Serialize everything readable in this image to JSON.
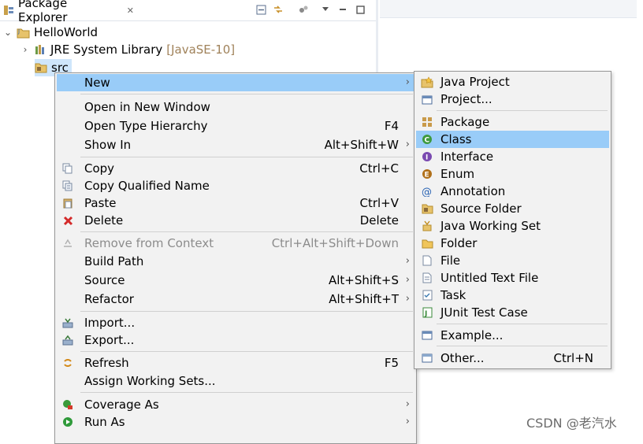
{
  "explorer": {
    "tab_title": "Package Explorer",
    "tab_close": "✕",
    "tree": {
      "project": "HelloWorld",
      "jre_label": "JRE System Library",
      "jre_decor": "[JavaSE-10]",
      "src": "src"
    }
  },
  "context_menu": {
    "items": [
      {
        "label": "New",
        "submenu": true,
        "highlighted": true
      },
      {
        "label": "Open in New Window"
      },
      {
        "label": "Open Type Hierarchy",
        "accel": "F4"
      },
      {
        "label": "Show In",
        "accel": "Alt+Shift+W",
        "submenu": true
      },
      {
        "label": "Copy",
        "accel": "Ctrl+C",
        "icon": "copy-icon"
      },
      {
        "label": "Copy Qualified Name",
        "icon": "copy-qualified-icon"
      },
      {
        "label": "Paste",
        "accel": "Ctrl+V",
        "icon": "paste-icon"
      },
      {
        "label": "Delete",
        "accel": "Delete",
        "icon": "delete-icon"
      },
      {
        "label": "Remove from Context",
        "accel": "Ctrl+Alt+Shift+Down",
        "disabled": true,
        "icon": "remove-context-icon"
      },
      {
        "label": "Build Path",
        "submenu": true
      },
      {
        "label": "Source",
        "accel": "Alt+Shift+S",
        "submenu": true
      },
      {
        "label": "Refactor",
        "accel": "Alt+Shift+T",
        "submenu": true
      },
      {
        "label": "Import...",
        "icon": "import-icon"
      },
      {
        "label": "Export...",
        "icon": "export-icon"
      },
      {
        "label": "Refresh",
        "accel": "F5",
        "icon": "refresh-icon"
      },
      {
        "label": "Assign Working Sets..."
      },
      {
        "label": "Coverage As",
        "submenu": true,
        "icon": "coverage-icon"
      },
      {
        "label": "Run As",
        "submenu": true,
        "icon": "run-icon"
      }
    ]
  },
  "new_submenu": {
    "items": [
      {
        "label": "Java Project",
        "icon": "java-project-icon"
      },
      {
        "label": "Project...",
        "icon": "project-icon"
      },
      {
        "label": "Package",
        "icon": "package-icon"
      },
      {
        "label": "Class",
        "icon": "class-icon",
        "highlighted": true
      },
      {
        "label": "Interface",
        "icon": "interface-icon"
      },
      {
        "label": "Enum",
        "icon": "enum-icon"
      },
      {
        "label": "Annotation",
        "icon": "annotation-icon"
      },
      {
        "label": "Source Folder",
        "icon": "source-folder-icon"
      },
      {
        "label": "Java Working Set",
        "icon": "working-set-icon"
      },
      {
        "label": "Folder",
        "icon": "folder-icon"
      },
      {
        "label": "File",
        "icon": "file-icon"
      },
      {
        "label": "Untitled Text File",
        "icon": "text-file-icon"
      },
      {
        "label": "Task",
        "icon": "task-icon"
      },
      {
        "label": "JUnit Test Case",
        "icon": "junit-icon"
      },
      {
        "label": "Example...",
        "icon": "example-icon"
      },
      {
        "label": "Other...",
        "accel": "Ctrl+N",
        "icon": "other-icon"
      }
    ]
  },
  "glyphs": {
    "submenu_arrow": "›",
    "twisty_open": "⌄",
    "twisty_closed": "›"
  },
  "watermark": "CSDN @老汽水",
  "colors": {
    "highlight": "#99ccf8",
    "menu_bg": "#f2f2f2",
    "disabled_text": "#8c8c8c",
    "jre_decor": "#a0825a"
  }
}
